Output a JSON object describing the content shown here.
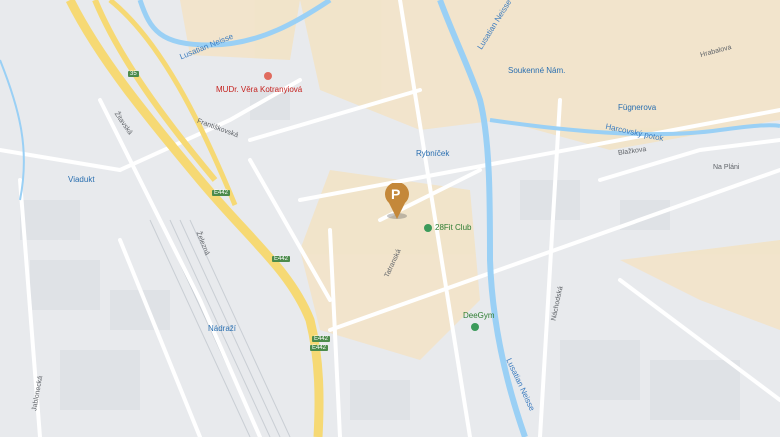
{
  "map": {
    "pin_label": "P",
    "labels": {
      "lusatian_top": "Lusatian Neisse",
      "lusatian_bottom": "Lusatian Neisse",
      "harcovsky": "Harcovský potok",
      "vera": "MUDr. Věra Kotranyiová",
      "rybnicek": "Rybníček",
      "soukenne": "Soukenné Nám.",
      "fugnerova": "Fügnerova",
      "fit": "28Fit Club",
      "deegym": "DeeGym",
      "viaduct": "Viadukt",
      "nadrazi": "Nádraží",
      "na_plani": "Na Pláni",
      "nachodska": "Náchodská",
      "zelezna": "Železná",
      "zitavska": "Žitavská",
      "frantiskovska": "Františkovská",
      "tatranska": "Tatranská",
      "hrabalova": "Hrabalova",
      "jablonecka": "Jablonecká",
      "blazkova": "Blažkova"
    },
    "road_shields": [
      "35",
      "E442",
      "E442",
      "E442",
      "E442"
    ],
    "colors": {
      "water": "#9ad0f5",
      "highway": "#f6d974",
      "urban": "#f5ead7",
      "pin": "#c4883a"
    }
  }
}
